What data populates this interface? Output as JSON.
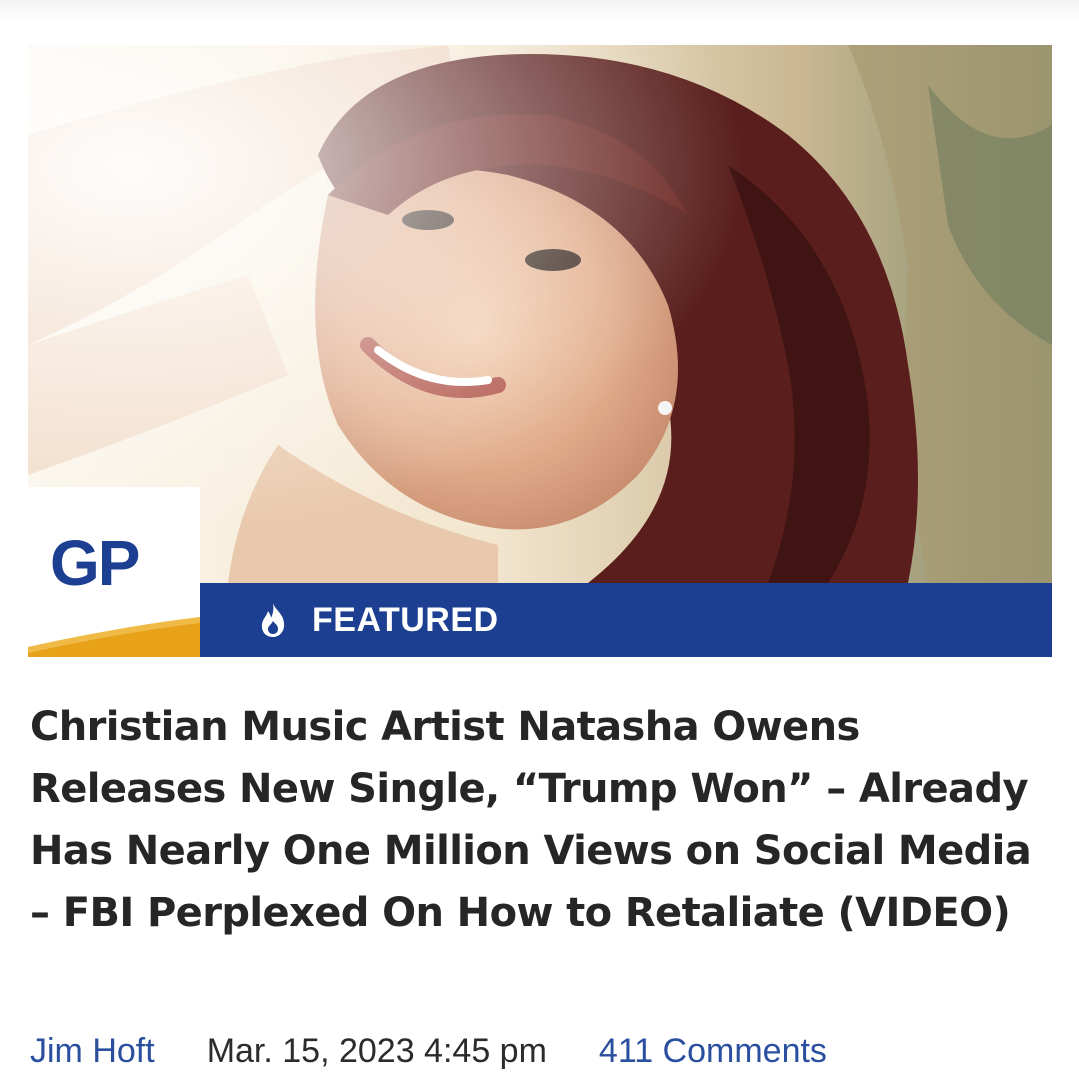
{
  "article": {
    "badge": {
      "label": "FEATURED",
      "icon": "flame-icon"
    },
    "logo": {
      "text": "GP",
      "color": "#1d3f91",
      "accent": "#e8a21a"
    },
    "headline": "Christian Music Artist Natasha Owens Releases New Single, “Trump Won” – Already Has Nearly One Million Views on Social Media – FBI Perplexed On How to Retaliate (VIDEO)",
    "author": "Jim Hoft",
    "date": "Mar. 15, 2023 4:45 pm",
    "comments": "411 Comments"
  },
  "colors": {
    "brand_blue": "#1d3f91",
    "link_blue": "#2a4f9f",
    "headline_text": "#262626"
  }
}
